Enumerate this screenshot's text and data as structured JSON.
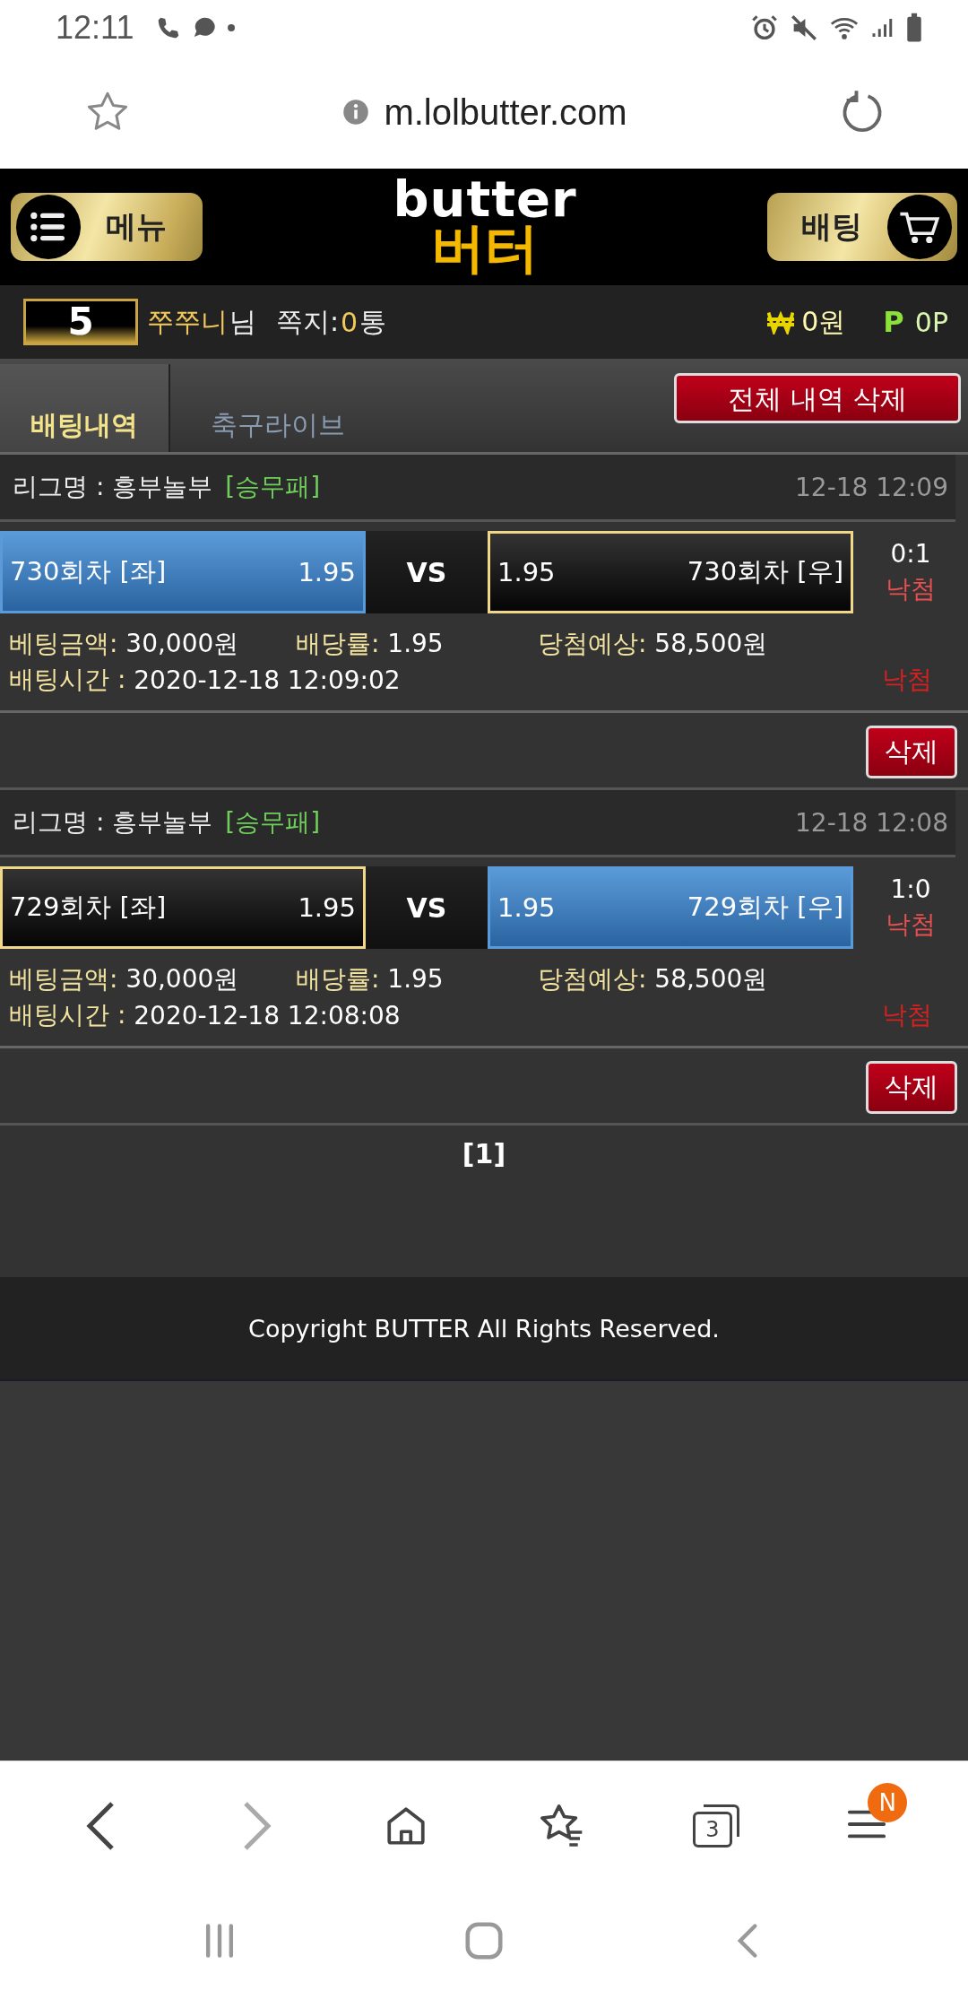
{
  "status_bar": {
    "time": "12:11"
  },
  "browser": {
    "url": "m.lolbutter.com"
  },
  "header": {
    "menu_button": "메뉴",
    "logo_latin": "butter",
    "logo_korean": "버터",
    "bet_button": "배팅"
  },
  "user_bar": {
    "level": "5",
    "nickname": "쭈쭈니",
    "suffix": "님",
    "messages_label": "쪽지:",
    "messages_count": "0",
    "messages_unit": "통",
    "money": "0원",
    "points_icon": "P",
    "points": "0P"
  },
  "tabs": [
    {
      "label": "배팅내역",
      "selected": true
    },
    {
      "label": "축구라이브",
      "selected": false
    }
  ],
  "delete_all_button": "전체 내역 삭제",
  "bets": [
    {
      "league_label": "리그명 : 흥부놀부",
      "market": "[승무패]",
      "date": "12-18 12:09",
      "left": {
        "name": "730회차 [좌]",
        "odds": "1.95",
        "selected": true
      },
      "vs": "VS",
      "right": {
        "odds": "1.95",
        "name": "730회차 [우]",
        "selected": false
      },
      "score": "0:1",
      "result": "낙첨",
      "amount_label": "베팅금액:",
      "amount": "30,000원",
      "rate_label": "배당률:",
      "rate": "1.95",
      "expected_label": "당첨예상:",
      "expected": "58,500원",
      "time_label": "배팅시간 :",
      "time": "2020-12-18 12:09:02",
      "status": "낙첨",
      "delete_button": "삭제"
    },
    {
      "league_label": "리그명 : 흥부놀부",
      "market": "[승무패]",
      "date": "12-18 12:08",
      "left": {
        "name": "729회차 [좌]",
        "odds": "1.95",
        "selected": false
      },
      "vs": "VS",
      "right": {
        "odds": "1.95",
        "name": "729회차 [우]",
        "selected": true
      },
      "score": "1:0",
      "result": "낙첨",
      "amount_label": "베팅금액:",
      "amount": "30,000원",
      "rate_label": "배당률:",
      "rate": "1.95",
      "expected_label": "당첨예상:",
      "expected": "58,500원",
      "time_label": "배팅시간 :",
      "time": "2020-12-18 12:08:08",
      "status": "낙첨",
      "delete_button": "삭제"
    }
  ],
  "pagination": "[1]",
  "footer": "Copyright BUTTER All Rights Reserved.",
  "bottom_nav": {
    "tabs_count": "3",
    "menu_badge": "N"
  }
}
